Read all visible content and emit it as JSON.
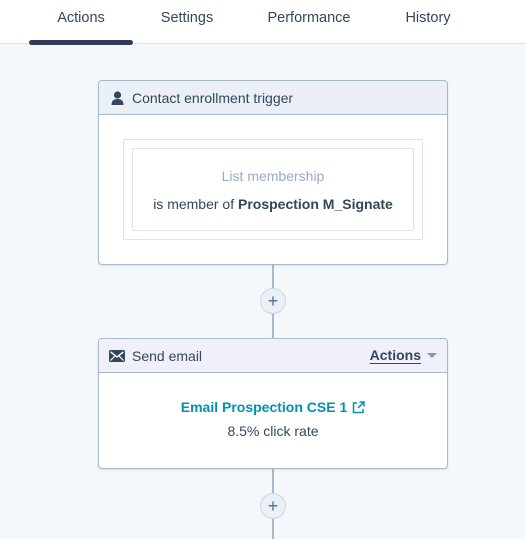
{
  "tabs": [
    {
      "label": "Actions",
      "active": true
    },
    {
      "label": "Settings"
    },
    {
      "label": "Performance"
    },
    {
      "label": "History"
    }
  ],
  "trigger": {
    "title": "Contact enrollment trigger",
    "icon": "person-icon",
    "filter_title": "List membership",
    "filter_prefix": "is member of",
    "filter_value": "Prospection M_Signate"
  },
  "add_button": {
    "label": "+"
  },
  "email_action": {
    "title": "Send email",
    "icon": "envelope-icon",
    "actions_label": "Actions",
    "email_name": "Email Prospection CSE 1",
    "click_rate": "8.5% click rate"
  },
  "colors": {
    "background": "#f5f8fa",
    "text": "#33475b",
    "link": "#0091ae",
    "border": "#a7b9cd",
    "tab_indicator": "#2d3e50"
  }
}
